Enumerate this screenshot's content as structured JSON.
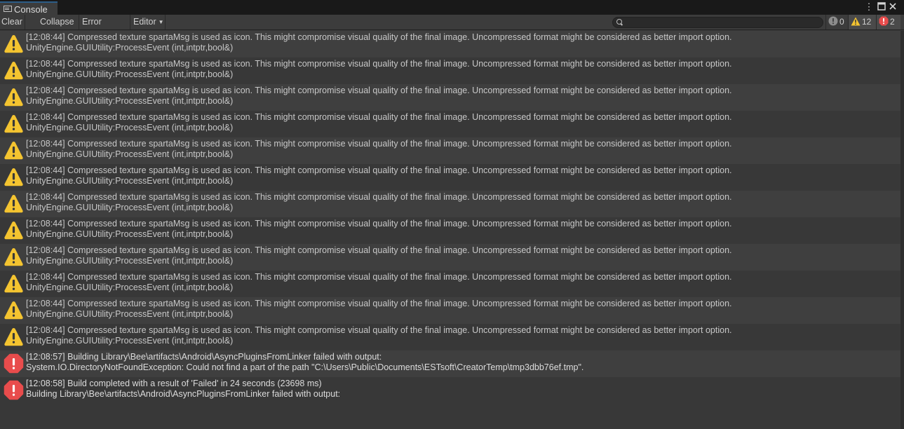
{
  "window": {
    "tab_title": "Console",
    "menu_icon": "kebab-menu-icon",
    "maximize_icon": "maximize-icon",
    "close_icon": "close-icon"
  },
  "toolbar": {
    "clear_label": "Clear",
    "collapse_label": "Collapse",
    "error_pause_label": "Error Pause",
    "editor_label": "Editor",
    "search_value": "",
    "info_count": "0",
    "warning_count": "12",
    "error_count": "2"
  },
  "colors": {
    "warning": "#f4c430",
    "error": "#e84c4c",
    "info": "#9a9a9a"
  },
  "entries": [
    {
      "type": "warning",
      "line1": "[12:08:44] Compressed texture spartaMsg is used as icon. This might compromise visual quality of the final image. Uncompressed format might be considered as better import option.",
      "line2": "UnityEngine.GUIUtility:ProcessEvent (int,intptr,bool&)"
    },
    {
      "type": "warning",
      "line1": "[12:08:44] Compressed texture spartaMsg is used as icon. This might compromise visual quality of the final image. Uncompressed format might be considered as better import option.",
      "line2": "UnityEngine.GUIUtility:ProcessEvent (int,intptr,bool&)"
    },
    {
      "type": "warning",
      "line1": "[12:08:44] Compressed texture spartaMsg is used as icon. This might compromise visual quality of the final image. Uncompressed format might be considered as better import option.",
      "line2": "UnityEngine.GUIUtility:ProcessEvent (int,intptr,bool&)"
    },
    {
      "type": "warning",
      "line1": "[12:08:44] Compressed texture spartaMsg is used as icon. This might compromise visual quality of the final image. Uncompressed format might be considered as better import option.",
      "line2": "UnityEngine.GUIUtility:ProcessEvent (int,intptr,bool&)"
    },
    {
      "type": "warning",
      "line1": "[12:08:44] Compressed texture spartaMsg is used as icon. This might compromise visual quality of the final image. Uncompressed format might be considered as better import option.",
      "line2": "UnityEngine.GUIUtility:ProcessEvent (int,intptr,bool&)"
    },
    {
      "type": "warning",
      "line1": "[12:08:44] Compressed texture spartaMsg is used as icon. This might compromise visual quality of the final image. Uncompressed format might be considered as better import option.",
      "line2": "UnityEngine.GUIUtility:ProcessEvent (int,intptr,bool&)"
    },
    {
      "type": "warning",
      "line1": "[12:08:44] Compressed texture spartaMsg is used as icon. This might compromise visual quality of the final image. Uncompressed format might be considered as better import option.",
      "line2": "UnityEngine.GUIUtility:ProcessEvent (int,intptr,bool&)"
    },
    {
      "type": "warning",
      "line1": "[12:08:44] Compressed texture spartaMsg is used as icon. This might compromise visual quality of the final image. Uncompressed format might be considered as better import option.",
      "line2": "UnityEngine.GUIUtility:ProcessEvent (int,intptr,bool&)"
    },
    {
      "type": "warning",
      "line1": "[12:08:44] Compressed texture spartaMsg is used as icon. This might compromise visual quality of the final image. Uncompressed format might be considered as better import option.",
      "line2": "UnityEngine.GUIUtility:ProcessEvent (int,intptr,bool&)"
    },
    {
      "type": "warning",
      "line1": "[12:08:44] Compressed texture spartaMsg is used as icon. This might compromise visual quality of the final image. Uncompressed format might be considered as better import option.",
      "line2": "UnityEngine.GUIUtility:ProcessEvent (int,intptr,bool&)"
    },
    {
      "type": "warning",
      "line1": "[12:08:44] Compressed texture spartaMsg is used as icon. This might compromise visual quality of the final image. Uncompressed format might be considered as better import option.",
      "line2": "UnityEngine.GUIUtility:ProcessEvent (int,intptr,bool&)"
    },
    {
      "type": "warning",
      "line1": "[12:08:44] Compressed texture spartaMsg is used as icon. This might compromise visual quality of the final image. Uncompressed format might be considered as better import option.",
      "line2": "UnityEngine.GUIUtility:ProcessEvent (int,intptr,bool&)"
    },
    {
      "type": "error",
      "line1": "[12:08:57] Building Library\\Bee\\artifacts\\Android\\AsyncPluginsFromLinker failed with output:",
      "line2": "System.IO.DirectoryNotFoundException: Could not find a part of the path \"C:\\Users\\Public\\Documents\\ESTsoft\\CreatorTemp\\tmp3dbb76ef.tmp\"."
    },
    {
      "type": "error",
      "line1": "[12:08:58] Build completed with a result of 'Failed' in 24 seconds (23698 ms)",
      "line2": "Building Library\\Bee\\artifacts\\Android\\AsyncPluginsFromLinker failed with output:"
    }
  ]
}
